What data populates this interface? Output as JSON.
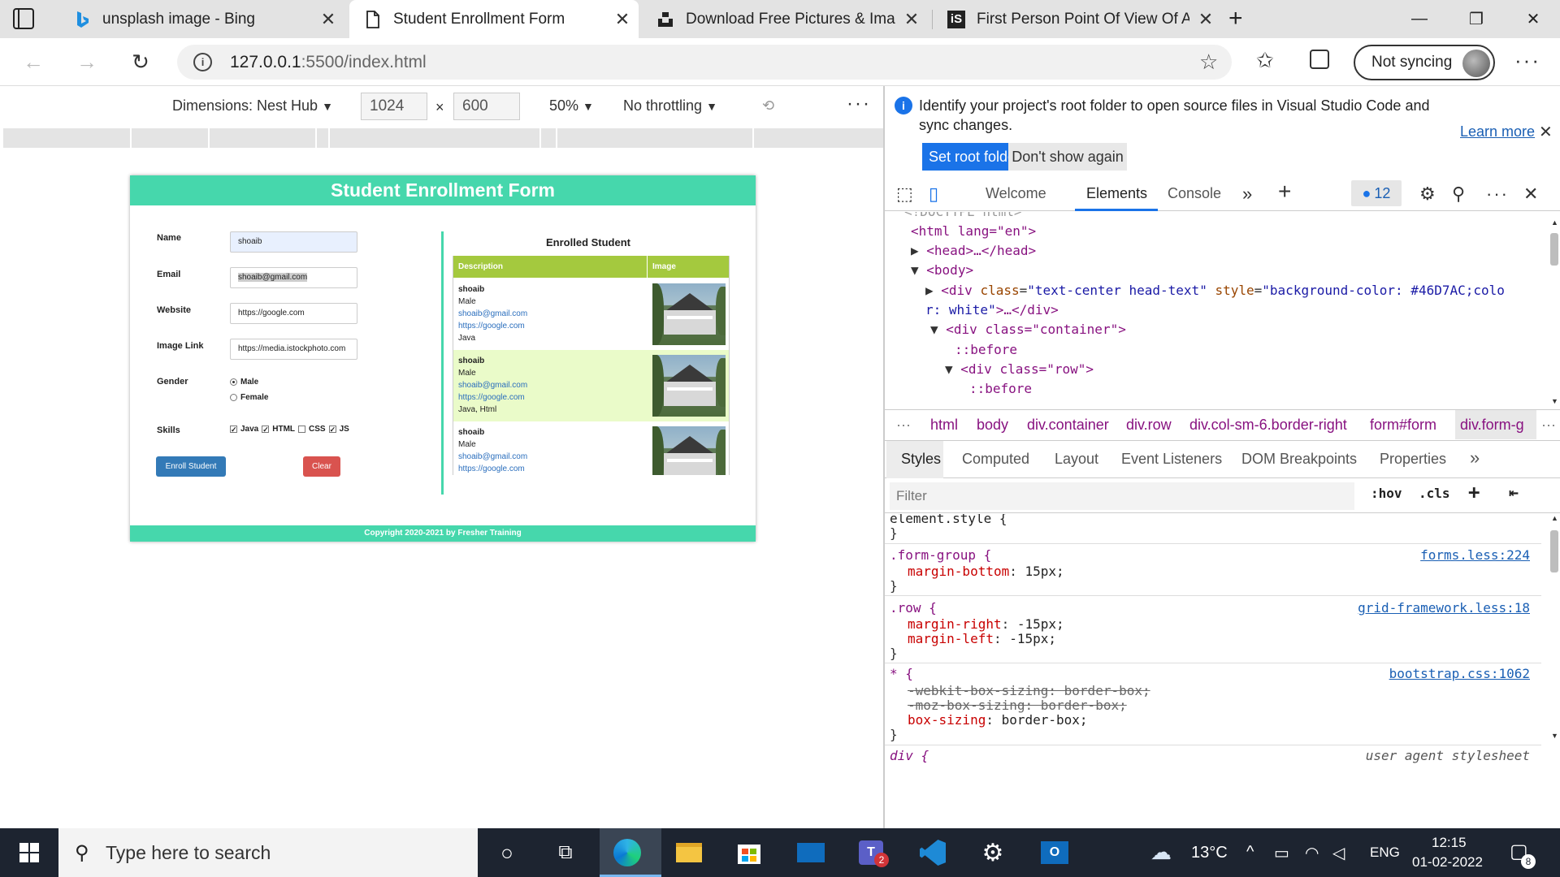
{
  "browser": {
    "tabs": [
      {
        "title": "unsplash image - Bing",
        "icon": "bing-icon",
        "active": false
      },
      {
        "title": "Student Enrollment Form",
        "icon": "page-icon",
        "active": true
      },
      {
        "title": "Download Free Pictures & Images",
        "icon": "unsplash-icon",
        "active": false
      },
      {
        "title": "First Person Point Of View Of A W",
        "icon": "istock-icon",
        "active": false
      }
    ],
    "url_host": "127.0.0.1",
    "url_rest": ":5500/index.html",
    "sync_label": "Not syncing"
  },
  "device_toolbar": {
    "dimensions_label": "Dimensions: Nest Hub",
    "width_value": "1024",
    "height_value": "600",
    "times": "×",
    "zoom": "50%",
    "throttling": "No throttling"
  },
  "form_page": {
    "header": "Student Enrollment Form",
    "header_color": "#46D7AC",
    "fields": {
      "name_label": "Name",
      "name_value": "shoaib",
      "email_label": "Email",
      "email_value": "shoaib@gmail.com",
      "website_label": "Website",
      "website_value": "https://google.com",
      "image_label": "Image Link",
      "image_value": "https://media.istockphoto.com",
      "gender_label": "Gender",
      "gender_male": "Male",
      "gender_female": "Female",
      "skills_label": "Skills",
      "skill_java": "Java",
      "skill_html": "HTML",
      "skill_css": "CSS",
      "skill_js": "JS"
    },
    "enroll_button": "Enroll Student",
    "clear_button": "Clear",
    "enrolled_title": "Enrolled Student",
    "table_headers": {
      "description": "Description",
      "image": "Image"
    },
    "students": [
      {
        "name": "shoaib",
        "gender": "Male",
        "email": "shoaib@gmail.com",
        "website": "https://google.com",
        "skills": "Java"
      },
      {
        "name": "shoaib",
        "gender": "Male",
        "email": "shoaib@gmail.com",
        "website": "https://google.com",
        "skills": "Java, Html"
      },
      {
        "name": "shoaib",
        "gender": "Male",
        "email": "shoaib@gmail.com",
        "website": "https://google.com",
        "skills": ""
      }
    ],
    "footer": "Copyright 2020-2021 by Fresher Training"
  },
  "devtools": {
    "info_text": "Identify your project's root folder to open source files in Visual Studio Code and sync changes.",
    "learn_more": "Learn more",
    "set_root": "Set root folder",
    "dont_show": "Don't show again",
    "tabs": {
      "welcome": "Welcome",
      "elements": "Elements",
      "console": "Console"
    },
    "issues_count": "12",
    "dom": {
      "doctype": "<!DOCTYPE html>",
      "html_open": "<html lang=\"en\">",
      "head": "<head>…</head>",
      "body": "<body>",
      "div1_tag": "<div",
      "div1_attr1": "class",
      "div1_val1": "\"text-center head-text\"",
      "div1_attr2": "style",
      "div1_val2": "\"background-color: #46D7AC;colo",
      "div1_wrap": "r: white\"",
      "div1_end": ">…</div>",
      "container": "<div class=\"container\">",
      "before1": "::before",
      "row": "<div class=\"row\">",
      "before2": "::before"
    },
    "crumbs": [
      "html",
      "body",
      "div.container",
      "div.row",
      "div.col-sm-6.border-right",
      "form#form",
      "div.form-g"
    ],
    "subtabs": [
      "Styles",
      "Computed",
      "Layout",
      "Event Listeners",
      "DOM Breakpoints",
      "Properties"
    ],
    "filter_placeholder": "Filter",
    "hov": ":hov",
    "cls": ".cls",
    "rules": {
      "element_style": "element.style {",
      "brace": "}",
      "fg_selector": ".form-group {",
      "fg_src": "forms.less:224",
      "fg_prop": "margin-bottom",
      "fg_val": "15px;",
      "row_selector": ".row {",
      "row_src": "grid-framework.less:18",
      "row_prop1": "margin-right",
      "row_val1": "-15px;",
      "row_prop2": "margin-left",
      "row_val2": "-15px;",
      "star_selector": "* {",
      "star_src": "bootstrap.css:1062",
      "star_l1": "-webkit-box-sizing: border-box;",
      "star_l2": "-moz-box-sizing: border-box;",
      "star_prop3": "box-sizing",
      "star_val3": "border-box;",
      "div_selector": "div {",
      "ua": "user agent stylesheet"
    }
  },
  "taskbar": {
    "search_placeholder": "Type here to search",
    "temperature": "13°C",
    "language": "ENG",
    "time": "12:15",
    "date": "01-02-2022",
    "teams_badge": "2",
    "notif_count": "8"
  }
}
